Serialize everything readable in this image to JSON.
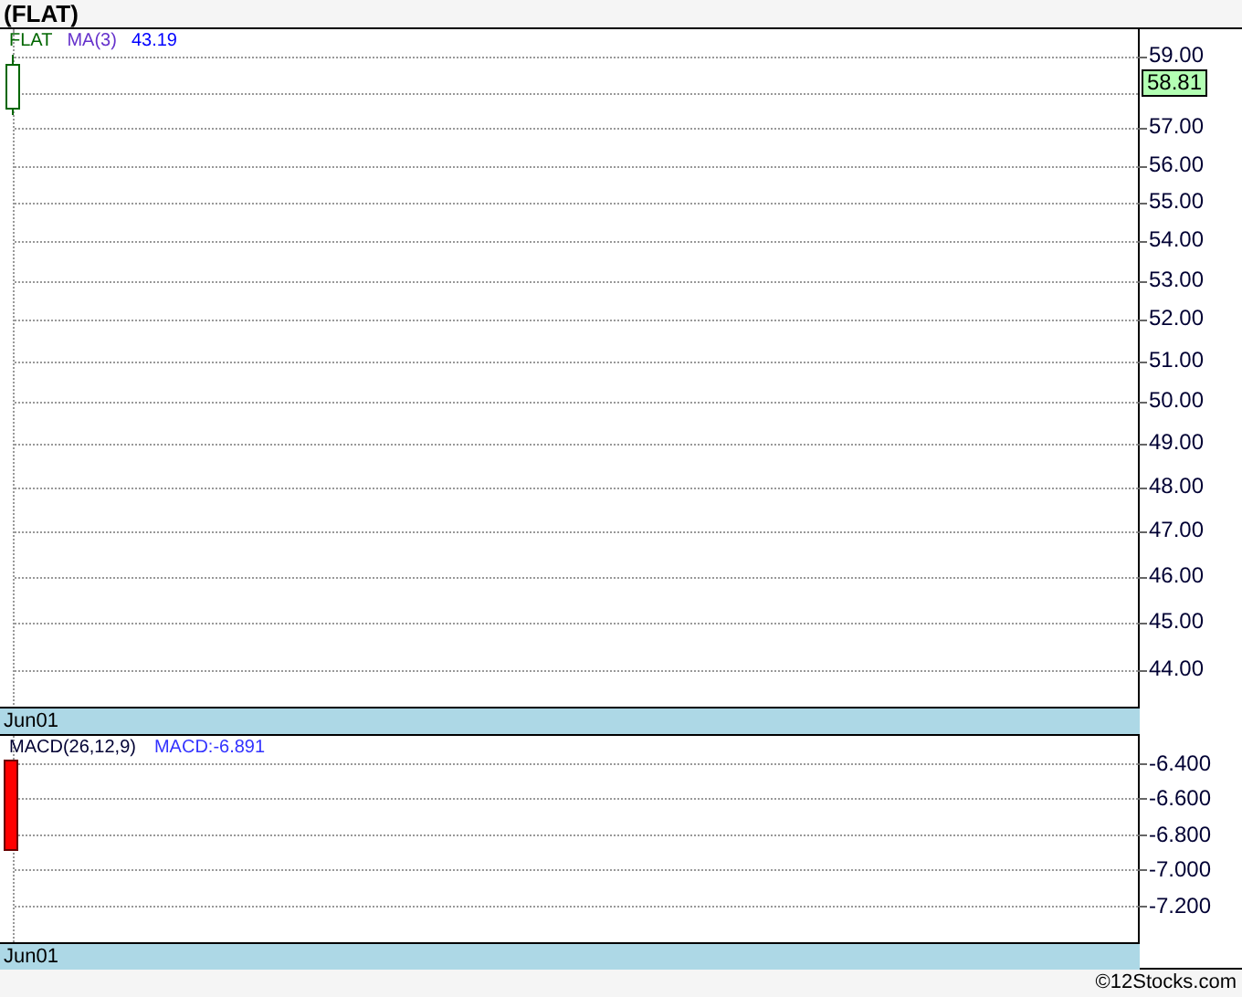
{
  "title": "(FLAT)",
  "price_panel": {
    "symbol": "FLAT",
    "indicator": "MA(3)",
    "indicator_value": "43.19",
    "axis_labels": [
      "59.00",
      "57.00",
      "56.00",
      "55.00",
      "54.00",
      "53.00",
      "52.00",
      "51.00",
      "50.00",
      "49.00",
      "48.00",
      "47.00",
      "46.00",
      "45.00",
      "44.00"
    ],
    "last_price": "58.81",
    "date_label": "Jun01"
  },
  "macd_panel": {
    "indicator": "MACD(26,12,9)",
    "value": "MACD:-6.891",
    "axis_labels": [
      "-6.400",
      "-6.600",
      "-6.800",
      "-7.000",
      "-7.200"
    ],
    "date_label": "Jun01"
  },
  "footer": "©12Stocks.com"
}
